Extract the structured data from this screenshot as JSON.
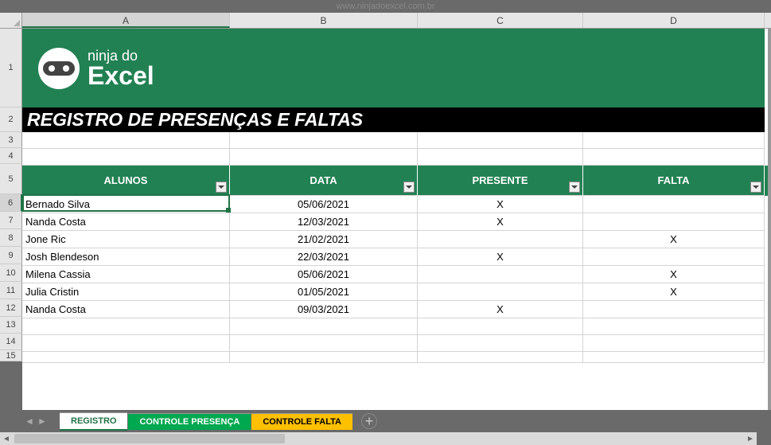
{
  "watermark": "www.ninjadoexcel.com.br",
  "columns": [
    "A",
    "B",
    "C",
    "D"
  ],
  "row_numbers": [
    1,
    2,
    3,
    4,
    5,
    6,
    7,
    8,
    9,
    10,
    11,
    12,
    13,
    14,
    15
  ],
  "logo": {
    "line1": "ninja do",
    "line2": "Excel"
  },
  "title": "REGISTRO DE PRESENÇAS E FALTAS",
  "table_headers": {
    "alunos": "ALUNOS",
    "data": "DATA",
    "presente": "PRESENTE",
    "falta": "FALTA"
  },
  "rows": [
    {
      "aluno": "Bernado Silva",
      "data": "05/06/2021",
      "presente": "X",
      "falta": ""
    },
    {
      "aluno": "Nanda Costa",
      "data": "12/03/2021",
      "presente": "X",
      "falta": ""
    },
    {
      "aluno": "Jone Ric",
      "data": "21/02/2021",
      "presente": "",
      "falta": "X"
    },
    {
      "aluno": "Josh Blendeson",
      "data": "22/03/2021",
      "presente": "X",
      "falta": ""
    },
    {
      "aluno": "Milena Cassia",
      "data": "05/06/2021",
      "presente": "",
      "falta": "X"
    },
    {
      "aluno": "Julia Cristin",
      "data": "01/05/2021",
      "presente": "",
      "falta": "X"
    },
    {
      "aluno": "Nanda Costa",
      "data": "09/03/2021",
      "presente": "X",
      "falta": ""
    }
  ],
  "tabs": {
    "registro": "REGISTRO",
    "controle_presenca": "CONTROLE PRESENÇA",
    "controle_falta": "CONTROLE FALTA"
  },
  "selected_cell": "A6"
}
